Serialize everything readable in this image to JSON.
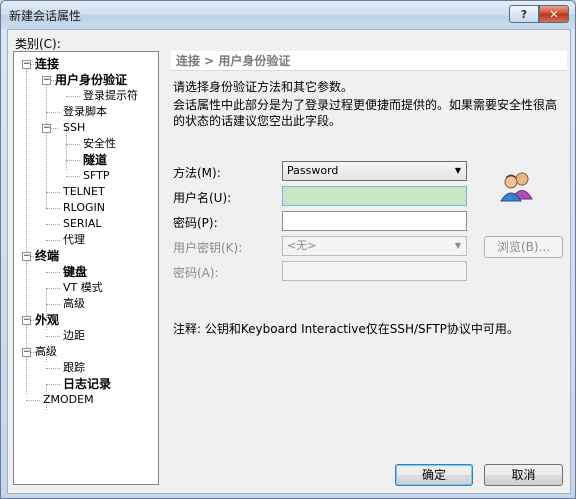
{
  "window": {
    "title": "新建会话属性",
    "help_label": "?",
    "close_label": "✕"
  },
  "sidebar": {
    "label": "类别(C):",
    "nodes": [
      {
        "id": "connect",
        "label": "连接",
        "bold": true,
        "expander": "−"
      },
      {
        "id": "auth",
        "label": "用户身份验证",
        "bold": true,
        "expander": "−"
      },
      {
        "id": "login-prompt",
        "label": "登录提示符",
        "bold": false
      },
      {
        "id": "login-script",
        "label": "登录脚本",
        "bold": false
      },
      {
        "id": "ssh",
        "label": "SSH",
        "bold": false,
        "expander": "−"
      },
      {
        "id": "security",
        "label": "安全性",
        "bold": false
      },
      {
        "id": "tunnel",
        "label": "隧道",
        "bold": true
      },
      {
        "id": "sftp",
        "label": "SFTP",
        "bold": false
      },
      {
        "id": "telnet",
        "label": "TELNET",
        "bold": false
      },
      {
        "id": "rlogin",
        "label": "RLOGIN",
        "bold": false
      },
      {
        "id": "serial",
        "label": "SERIAL",
        "bold": false
      },
      {
        "id": "proxy",
        "label": "代理",
        "bold": false
      },
      {
        "id": "terminal",
        "label": "终端",
        "bold": true,
        "expander": "−"
      },
      {
        "id": "keyboard",
        "label": "键盘",
        "bold": true
      },
      {
        "id": "vt-mode",
        "label": "VT 模式",
        "bold": false
      },
      {
        "id": "advanced",
        "label": "高级",
        "bold": false
      },
      {
        "id": "appearance",
        "label": "外观",
        "bold": true,
        "expander": "−"
      },
      {
        "id": "margin",
        "label": "边距",
        "bold": false
      },
      {
        "id": "advanced2",
        "label": "高级",
        "bold": false,
        "expander": "−"
      },
      {
        "id": "tracking",
        "label": "跟踪",
        "bold": false
      },
      {
        "id": "logging",
        "label": "日志记录",
        "bold": true
      },
      {
        "id": "zmodem",
        "label": "ZMODEM",
        "bold": false
      }
    ]
  },
  "panel": {
    "header": "连接 > 用户身份验证",
    "desc1": "请选择身份验证方法和其它参数。",
    "desc2": "会话属性中此部分是为了登录过程更便捷而提供的。如果需要安全性很高",
    "desc3": "的状态的话建议您空出此字段。",
    "method_label": "方法(M):",
    "method_value": "Password",
    "username_label": "用户名(U):",
    "username_value": "",
    "password_label": "密码(P):",
    "password_value": "",
    "userkey_label": "用户密钥(K):",
    "userkey_value": "<无>",
    "browse_label": "浏览(B)...",
    "passphrase_label": "密码(A):",
    "passphrase_value": "",
    "note": "注释: 公钥和Keyboard Interactive仅在SSH/SFTP协议中可用。"
  },
  "footer": {
    "ok_label": "确定",
    "cancel_label": "取消"
  }
}
